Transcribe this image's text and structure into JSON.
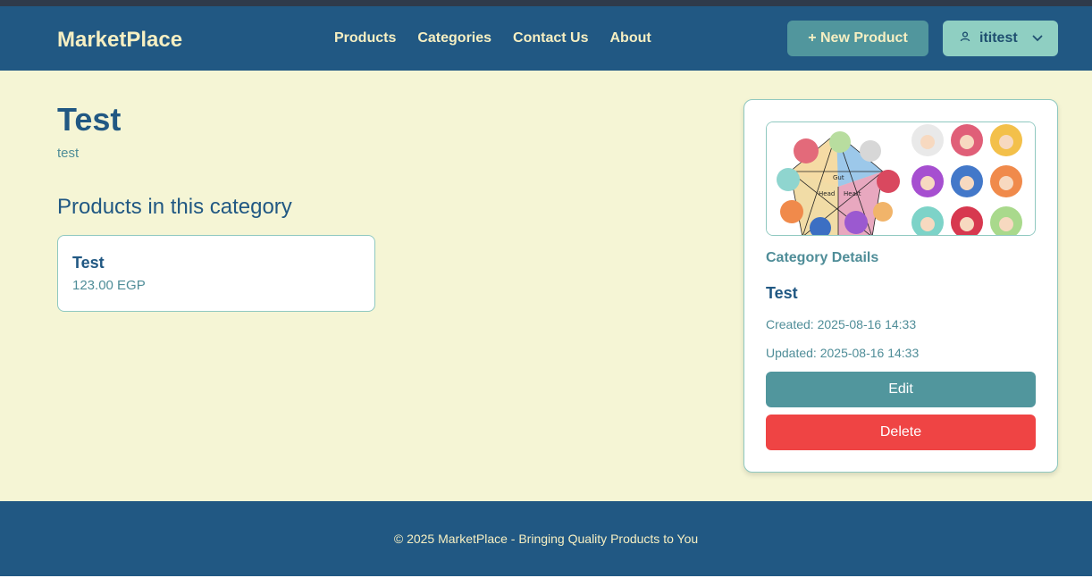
{
  "brand": "MarketPlace",
  "nav": {
    "links": [
      "Products",
      "Categories",
      "Contact Us",
      "About"
    ],
    "new_product_label": "+ New Product",
    "user_name": "ititest",
    "user_icon": "user-icon",
    "dropdown_icon": "chevron-down-icon"
  },
  "category": {
    "title": "Test",
    "description": "test"
  },
  "products_section": {
    "heading": "Products in this category",
    "items": [
      {
        "name": "Test",
        "price": "123.00 EGP"
      }
    ]
  },
  "details": {
    "image_alt": "Enneagram type chart with character portraits",
    "label": "Category Details",
    "name": "Test",
    "created": "Created: 2025-08-16 14:33",
    "updated": "Updated: 2025-08-16 14:33",
    "edit_label": "Edit",
    "delete_label": "Delete"
  },
  "footer": {
    "text": "© 2025 MarketPlace - Bringing Quality Products to You"
  },
  "colors": {
    "nav_bg": "#215883",
    "page_bg": "#f5f5d5",
    "accent": "#51969d",
    "danger": "#ef4444",
    "nav_text": "#f6efc2"
  }
}
